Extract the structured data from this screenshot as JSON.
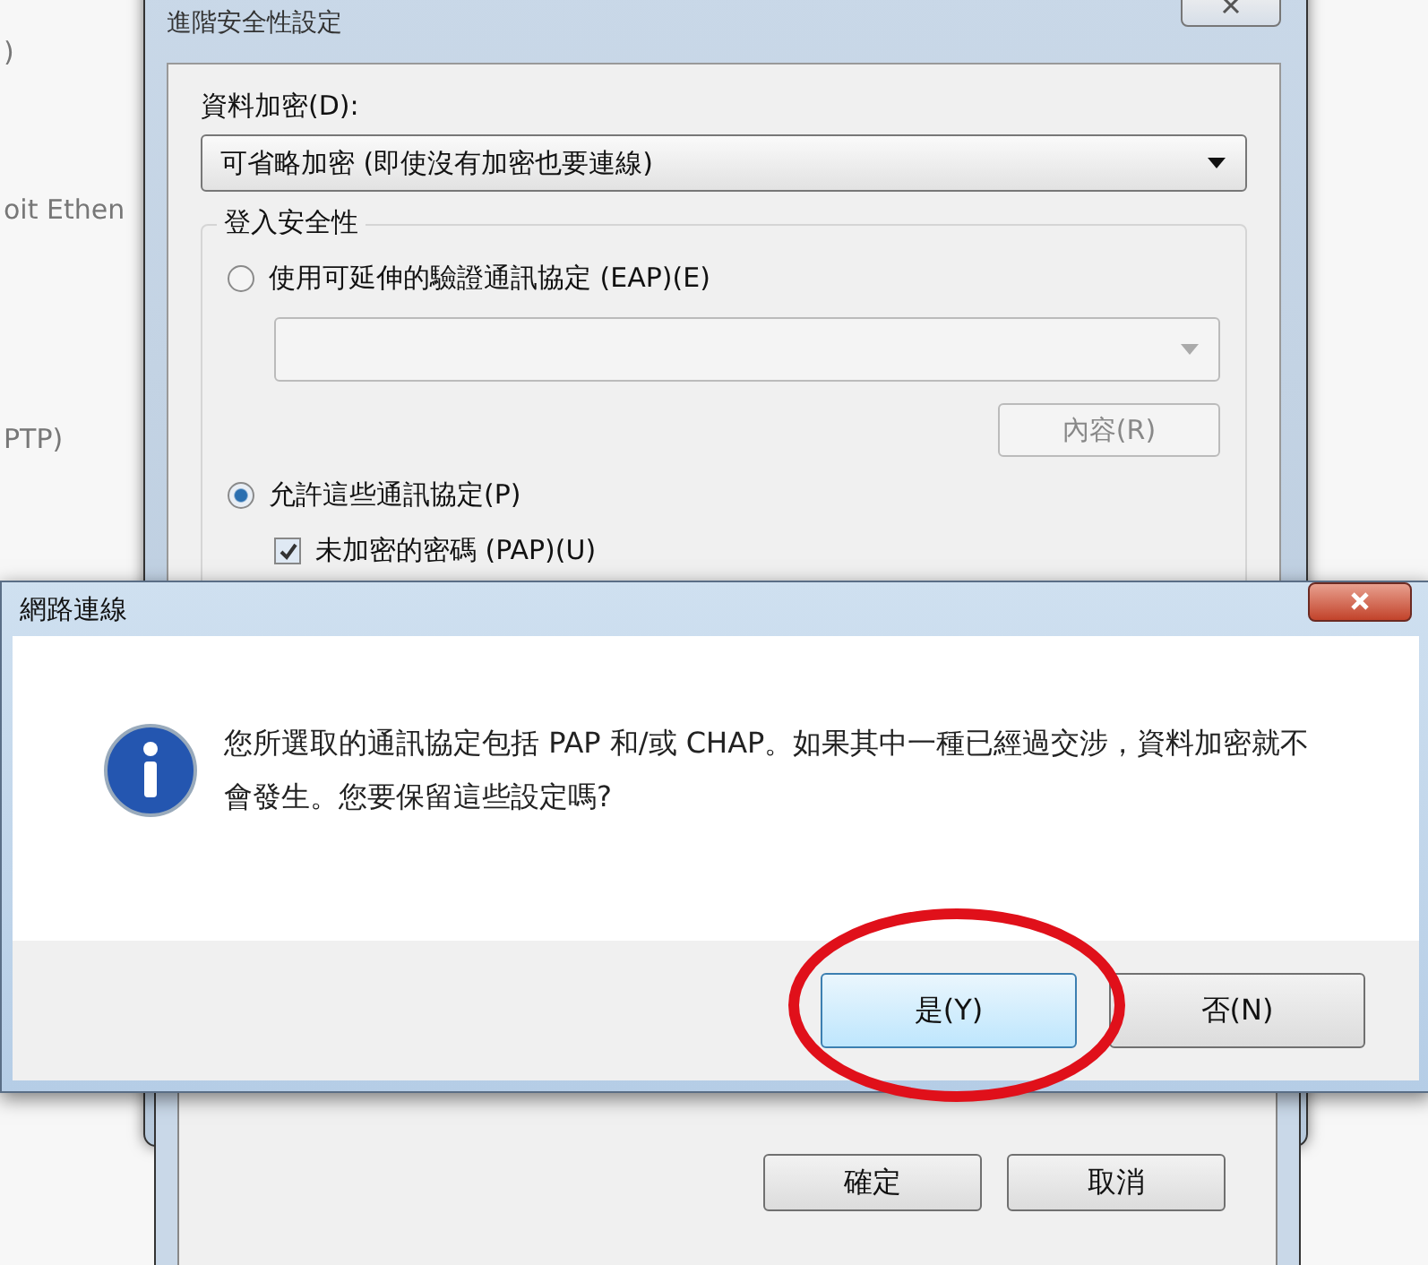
{
  "background_window": {
    "texts": [
      ")",
      "oit Ethen",
      "PTP)"
    ]
  },
  "advanced_dialog": {
    "title": "進階安全性設定",
    "encryption_label": "資料加密(D):",
    "encryption_value": "可省略加密 (即使沒有加密也要連線)",
    "group_title": "登入安全性",
    "options": [
      {
        "label": "使用可延伸的驗證通訊協定 (EAP)(E)",
        "selected": false
      },
      {
        "label": "允許這些通訊協定(P)",
        "selected": true
      }
    ],
    "properties_button": "內容(R)",
    "protocols": [
      {
        "label": "未加密的密碼 (PAP)(U)",
        "checked": true
      }
    ]
  },
  "message_box": {
    "title": "網路連線",
    "message": "您所選取的通訊協定包括 PAP 和/或 CHAP。如果其中一種已經過交涉，資料加密就不會發生。您要保留這些設定嗎?",
    "buttons": [
      {
        "label": "是(Y)",
        "selected": true
      },
      {
        "label": "否(N)",
        "selected": false
      }
    ]
  },
  "annotation": {
    "kind": "ellipse"
  },
  "lower_dialog": {
    "buttons": [
      "確定",
      "取消"
    ]
  }
}
